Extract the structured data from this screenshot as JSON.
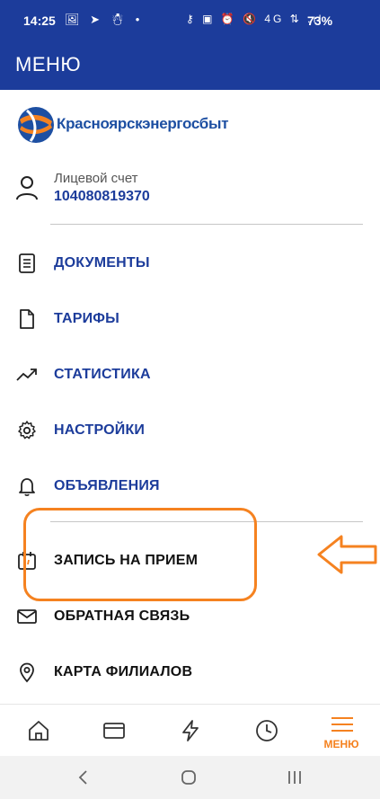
{
  "status_bar": {
    "time": "14:25",
    "left_icons": "🖼 ➤ ☃ •",
    "right_icons": "⚷ ▣ ⏰ 🔇 4G ⇅ .ıl",
    "battery": "73%"
  },
  "app_bar": {
    "title": "МЕНЮ"
  },
  "brand": {
    "name": "Красноярскэнергосбыт"
  },
  "account": {
    "label": "Лицевой счет",
    "number": "104080819370"
  },
  "menu": {
    "documents": "ДОКУМЕНТЫ",
    "tariffs": "ТАРИФЫ",
    "statistics": "СТАТИСТИКА",
    "settings": "НАСТРОЙКИ",
    "announcements": "ОБЪЯВЛЕНИЯ",
    "appointment": "ЗАПИСЬ НА ПРИЕМ",
    "feedback": "ОБРАТНАЯ СВЯЗЬ",
    "branches_map": "КАРТА ФИЛИАЛОВ"
  },
  "bottom_nav": {
    "menu_label": "МЕНЮ"
  },
  "colors": {
    "primary": "#1c3c9b",
    "accent": "#f58220",
    "brand_text": "#1d4fa2"
  }
}
